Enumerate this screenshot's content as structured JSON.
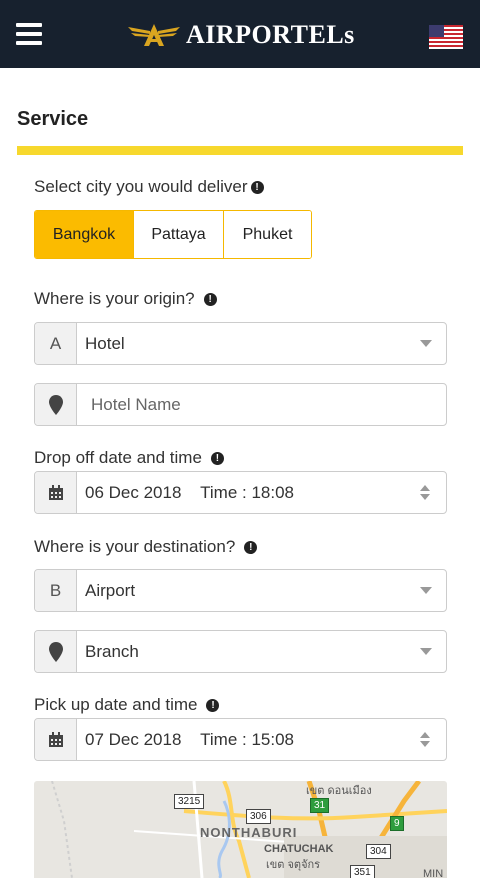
{
  "header": {
    "logo_text": "AIRPORTELs",
    "language_flag": "us-flag-icon"
  },
  "section_title": "Service",
  "city": {
    "label": "Select city you would deliver",
    "options": [
      "Bangkok",
      "Pattaya",
      "Phuket"
    ],
    "selected": "Bangkok"
  },
  "origin": {
    "label": "Where is your origin?",
    "type_prefix": "A",
    "type_value": "Hotel",
    "name_placeholder": "Hotel Name"
  },
  "dropoff": {
    "label": "Drop off date and time",
    "date": "06 Dec 2018",
    "time": "Time : 18:08"
  },
  "destination": {
    "label": "Where is your destination?",
    "type_prefix": "B",
    "type_value": "Airport",
    "branch_value": "Branch"
  },
  "pickup": {
    "label": "Pick up date and time",
    "date": "07 Dec 2018",
    "time": "Time : 15:08"
  },
  "map": {
    "place_label": "NONTHABURI",
    "district_label": "CHATUCHAK",
    "district_thai": "เขต จตุจักร",
    "area_thai": "เขต ดอนเมือง",
    "edge_label": "MIN",
    "routes": [
      "3215",
      "306",
      "31",
      "9",
      "304",
      "351"
    ]
  },
  "colors": {
    "header_bg": "#17212e",
    "accent_yellow": "#f7d82d",
    "selected_button": "#fbbb00"
  }
}
